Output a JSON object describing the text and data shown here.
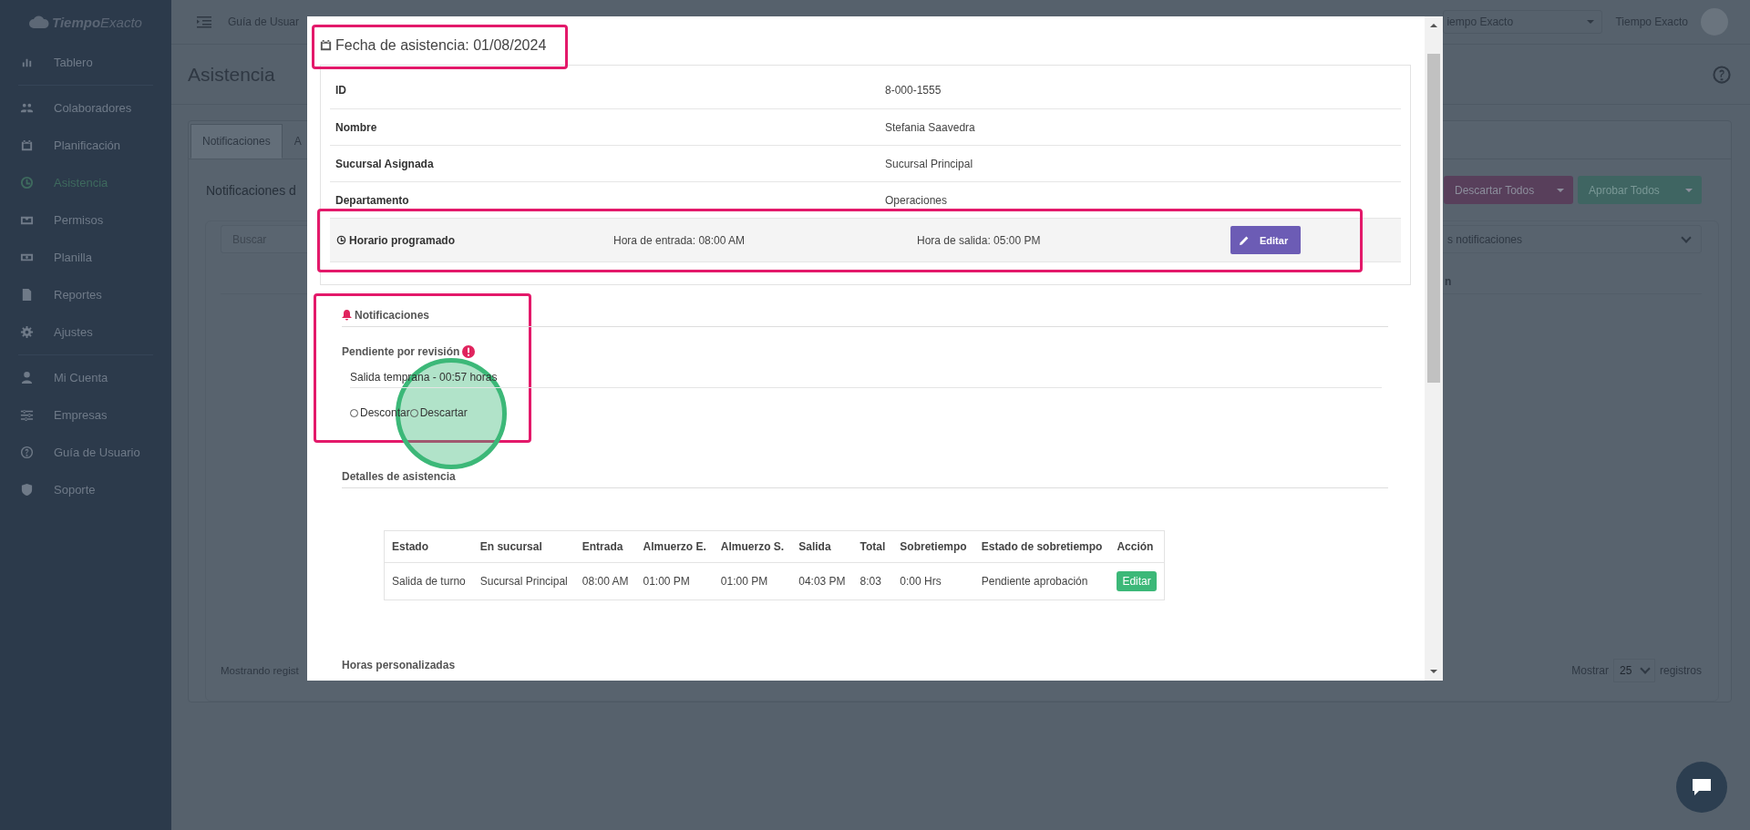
{
  "sidebar": {
    "logo": "**Tiempo**Exacto",
    "groups": [
      [
        {
          "label": "Tablero",
          "selected": false
        }
      ],
      [
        {
          "label": "Colaboradores",
          "selected": false
        },
        {
          "label": "Planificación",
          "selected": false
        },
        {
          "label": "Asistencia",
          "selected": true
        },
        {
          "label": "Permisos",
          "selected": false
        },
        {
          "label": "Planilla",
          "selected": false
        },
        {
          "label": "Reportes",
          "selected": false
        },
        {
          "label": "Ajustes",
          "selected": false
        }
      ],
      [
        {
          "label": "Mi Cuenta",
          "selected": false
        },
        {
          "label": "Empresas",
          "selected": false
        },
        {
          "label": "Guía de Usuario",
          "selected": false
        },
        {
          "label": "Soporte",
          "selected": false
        }
      ]
    ]
  },
  "topbar": {
    "guide_link": "Guía de Usuar",
    "company_select": "iempo Exacto",
    "user_name": "Tiempo Exacto"
  },
  "page": {
    "title": "Asistencia",
    "tabs": [
      {
        "label": "Notificaciones",
        "selected": true
      },
      {
        "label": "A",
        "selected": false
      }
    ],
    "section_title": "Notificaciones d",
    "buttons": [
      {
        "label": "Descartar Todos",
        "kind": "danger"
      },
      {
        "label": "Aprobar Todos",
        "kind": "success"
      }
    ],
    "search": {
      "placeholder": "Buscar"
    },
    "filter_select": "s notificaciones",
    "column_header": "n",
    "footer_info": "Mostrando regist",
    "page_size": {
      "label_before": "Mostrar",
      "value": "25",
      "label_after": "registros"
    }
  },
  "modal": {
    "title": "Fecha de asistencia: 01/08/2024",
    "info_rows": [
      {
        "label": "ID",
        "value": "8-000-1555"
      },
      {
        "label": "Nombre",
        "value": "Stefania Saavedra"
      },
      {
        "label": "Sucursal Asignada",
        "value": "Sucursal Principal"
      },
      {
        "label": "Departamento",
        "value": "Operaciones"
      }
    ],
    "schedule": {
      "label": "Horario programado",
      "start": "Hora de entrada: 08:00 AM",
      "end": "Hora de salida: 05:00 PM",
      "button": "Editar"
    },
    "notifications": {
      "title": "Notificaciones",
      "status": "Pendiente por revisión",
      "items": [
        {
          "text": "Salida temprana - 00:57 horas",
          "options": [
            {
              "label": "Descontar",
              "selected": false
            },
            {
              "label": "Descartar",
              "selected": false
            }
          ]
        }
      ]
    },
    "details": {
      "title": "Detalles de asistencia",
      "columns": [
        "Estado",
        "En sucursal",
        "Entrada",
        "Almuerzo E.",
        "Almuerzo S.",
        "Salida",
        "Total",
        "Sobretiempo",
        "Estado de sobretiempo",
        "Acción"
      ],
      "rows": [
        {
          "cells": [
            "Salida de turno",
            "Sucursal Principal",
            "08:00 AM",
            "01:00 PM",
            "01:00 PM",
            "04:03 PM",
            "8:03",
            "0:00 Hrs",
            "Pendiente aprobación"
          ],
          "action": "Editar"
        }
      ]
    },
    "next_section_title": "Horas personalizadas"
  }
}
